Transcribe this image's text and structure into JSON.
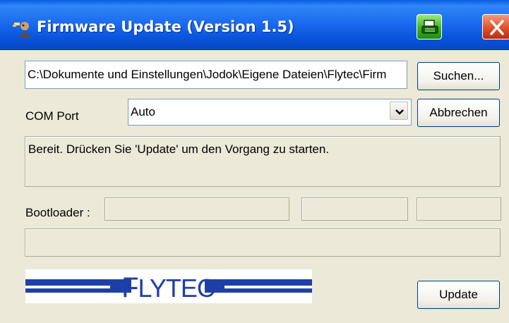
{
  "window": {
    "title": "Firmware Update (Version 1.5)"
  },
  "icons": {
    "app": "user-update-icon",
    "print": "printer-icon",
    "close": "close-icon",
    "dropdown": "chevron-down-icon"
  },
  "file": {
    "path": "C:\\Dokumente und Einstellungen\\Jodok\\Eigene Dateien\\Flytec\\Firm",
    "browse_label": "Suchen..."
  },
  "com": {
    "label": "COM Port",
    "selected": "Auto",
    "cancel_label": "Abbrechen"
  },
  "status": {
    "message": "Bereit. Drücken Sie 'Update' um den Vorgang zu starten."
  },
  "bootloader": {
    "label": "Bootloader :",
    "field1": "",
    "field2": "",
    "field3": ""
  },
  "progress": {
    "value": 0
  },
  "logo": {
    "text": "FLYTEC",
    "color": "#1f3fa8"
  },
  "actions": {
    "update_label": "Update"
  }
}
